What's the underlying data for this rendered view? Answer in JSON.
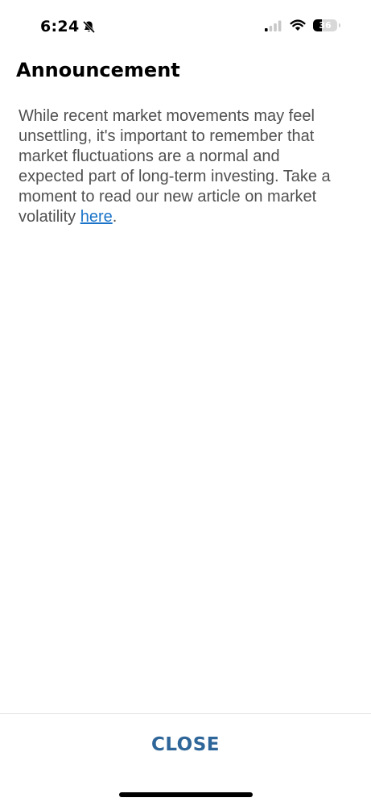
{
  "status_bar": {
    "time": "6:24",
    "silent_icon": "bell-slash-icon",
    "signal_icon": "cellular-signal-icon",
    "wifi_icon": "wifi-icon",
    "battery_percent": "36",
    "battery_level": 0.36
  },
  "announcement": {
    "title": "Announcement",
    "body_text": "While recent market movements may feel unsettling, it's important to remember that market fluctuations are a normal and expected part of long-term investing. Take a moment to read our new article on market volatility ",
    "link_text": "here",
    "trailing_text": "."
  },
  "footer": {
    "close_label": "CLOSE"
  },
  "colors": {
    "accent": "#2f6699",
    "link": "#1a73c8",
    "body_text": "#505050"
  }
}
